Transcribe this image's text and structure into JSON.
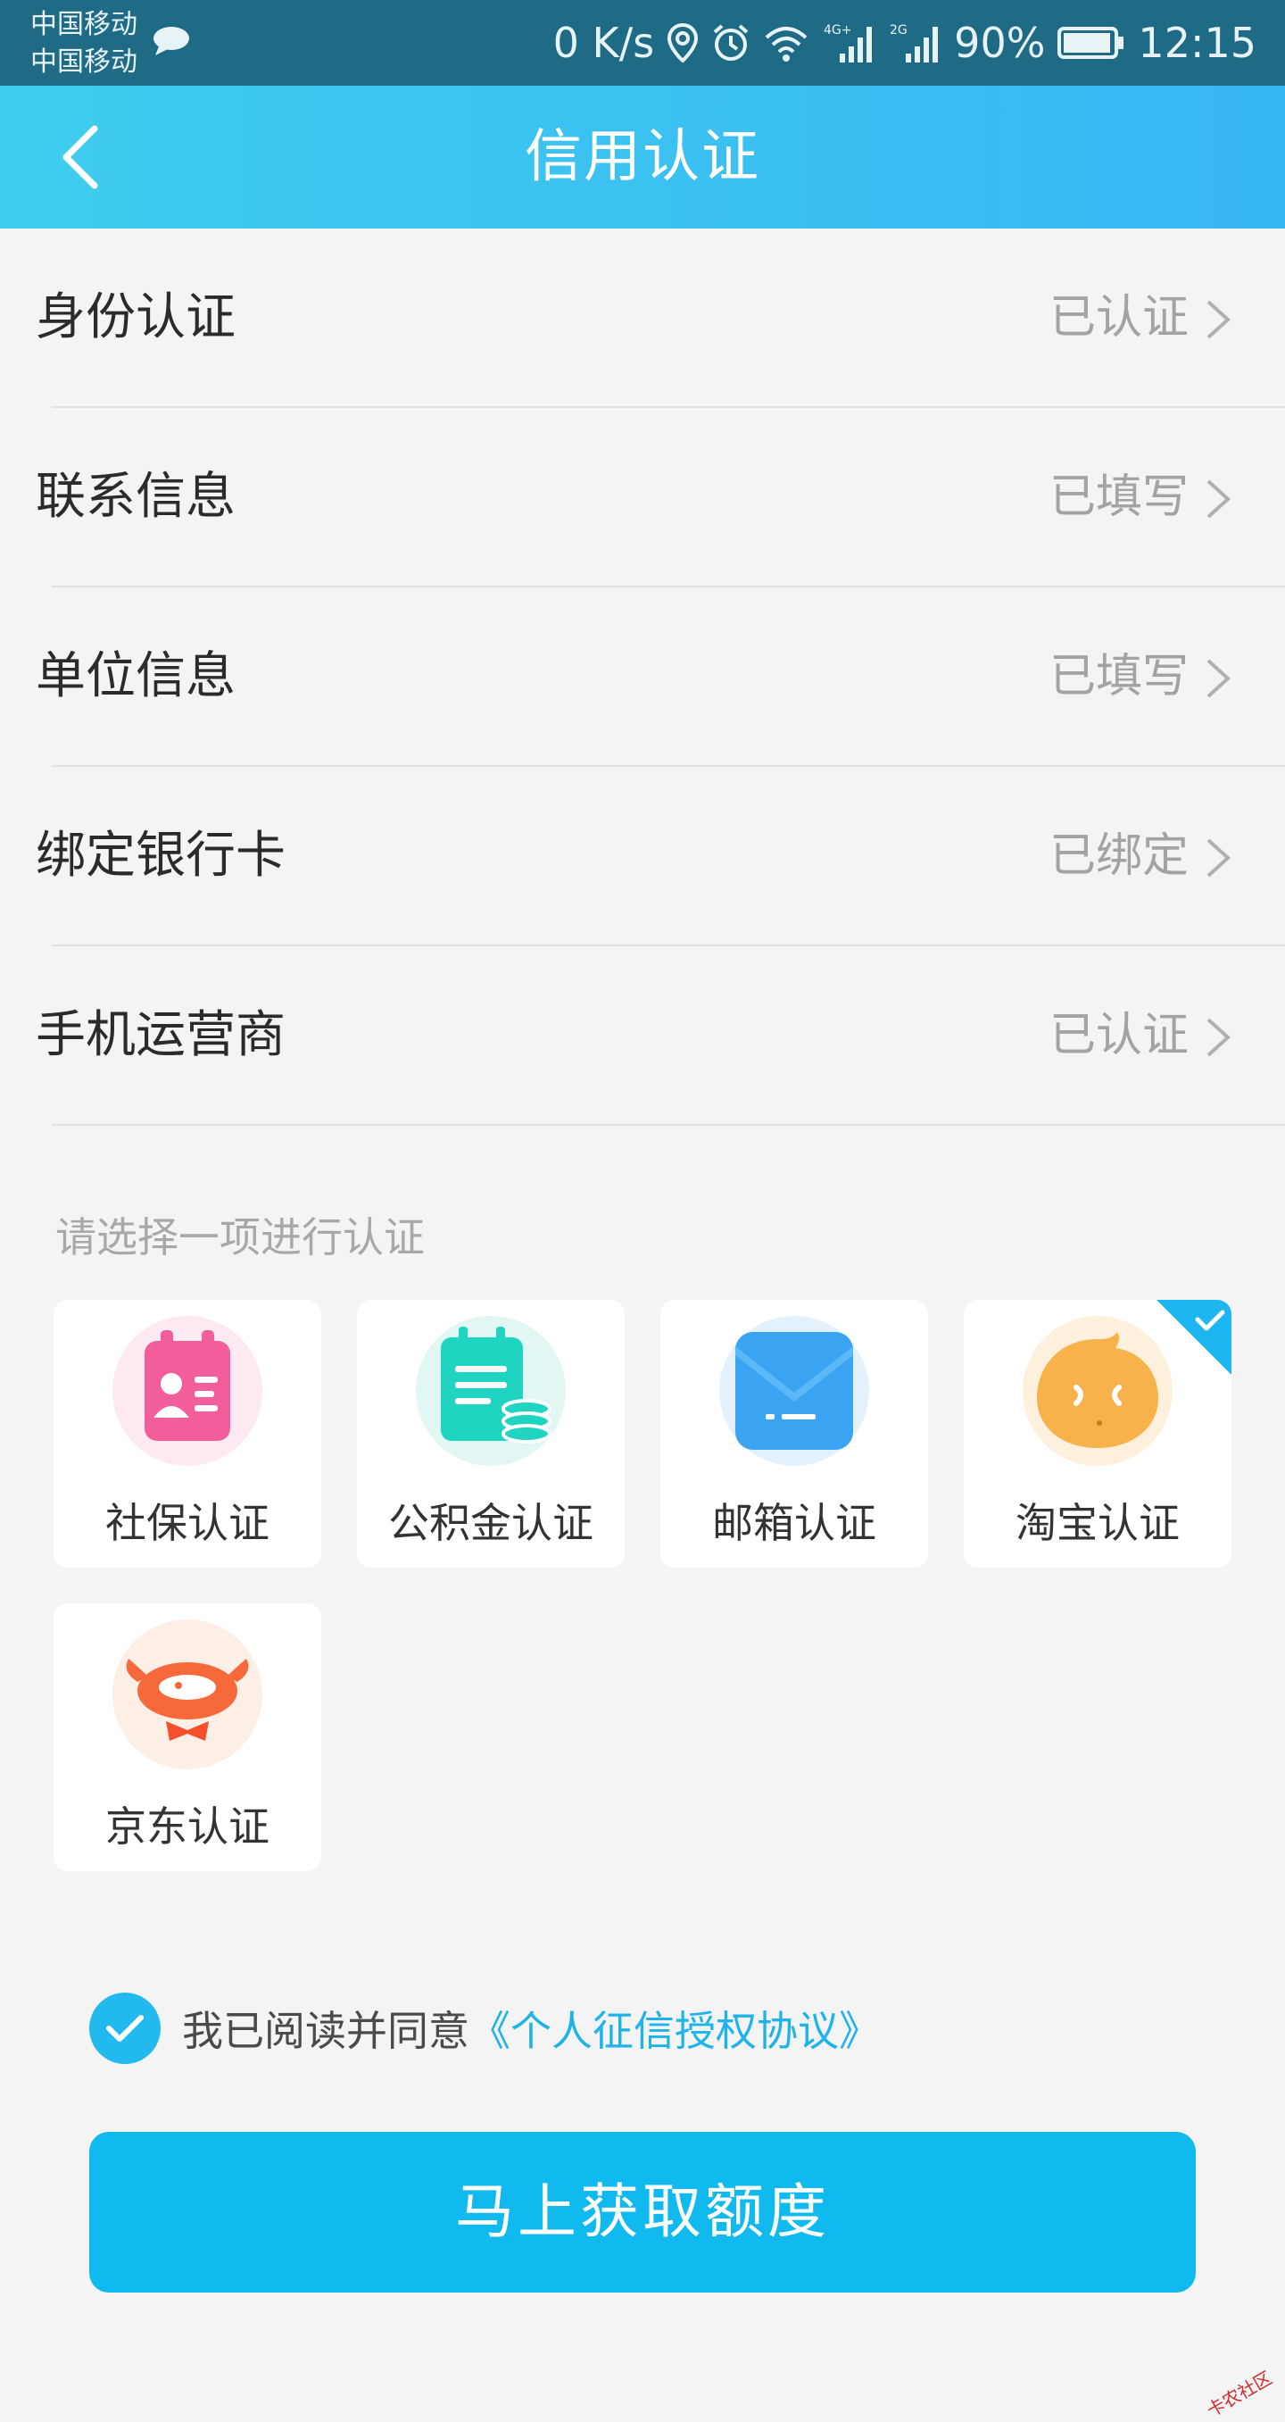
{
  "status_bar": {
    "carrier1": "中国移动",
    "carrier2": "中国移动",
    "net_speed": "0 K/s",
    "net1": "4G+",
    "net2": "2G",
    "battery": "90%",
    "time": "12:15",
    "icons": [
      "message-icon",
      "location-icon",
      "alarm-icon",
      "wifi-icon",
      "signal-icon",
      "battery-icon"
    ]
  },
  "header": {
    "title": "信用认证",
    "back_icon": "back-chevron-icon"
  },
  "verification_list": [
    {
      "label": "身份认证",
      "status": "已认证"
    },
    {
      "label": "联系信息",
      "status": "已填写"
    },
    {
      "label": "单位信息",
      "status": "已填写"
    },
    {
      "label": "绑定银行卡",
      "status": "已绑定"
    },
    {
      "label": "手机运营商",
      "status": "已认证"
    }
  ],
  "section_hint": "请选择一项进行认证",
  "options": [
    {
      "label": "社保认证",
      "icon": "social-security-icon",
      "selected": false
    },
    {
      "label": "公积金认证",
      "icon": "housing-fund-icon",
      "selected": false
    },
    {
      "label": "邮箱认证",
      "icon": "email-icon",
      "selected": false
    },
    {
      "label": "淘宝认证",
      "icon": "taobao-icon",
      "selected": true
    },
    {
      "label": "京东认证",
      "icon": "jd-icon",
      "selected": false
    }
  ],
  "agreement": {
    "text": "我已阅读并同意",
    "link": "《个人征信授权协议》",
    "checked": true
  },
  "cta_button": "马上获取额度",
  "watermark": "卡农社区",
  "colors": {
    "status_bar": "#1f6b85",
    "header_start": "#40cdee",
    "header_end": "#37b6f4",
    "accent": "#11baee",
    "link": "#1eb3ea",
    "background": "#f4f4f4"
  }
}
